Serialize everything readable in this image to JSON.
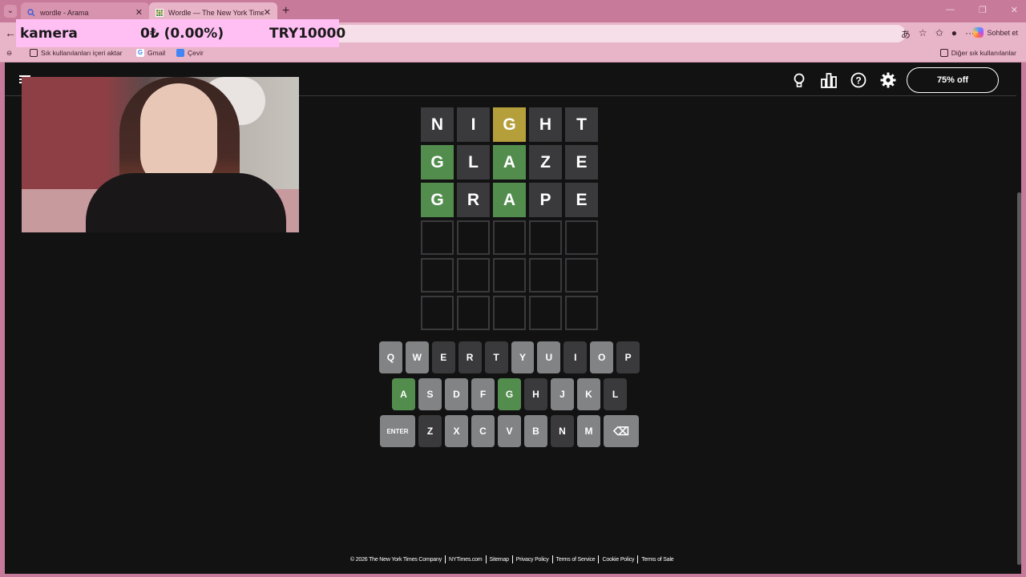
{
  "browser": {
    "tabs": [
      {
        "title": "wordle - Arama",
        "icon": "search-icon",
        "active": false
      },
      {
        "title": "Wordle — The New York Times",
        "icon": "wordle-favicon-icon",
        "active": true
      }
    ],
    "new_tab": "+",
    "copilot_label": "Sohbet et",
    "bookmarks": [
      {
        "label": "Sık kullanılanları içeri aktar",
        "icon": "import-icon"
      },
      {
        "label": "Gmail",
        "icon": "google-icon"
      },
      {
        "label": "Çevir",
        "icon": "translate-icon"
      }
    ],
    "other_bookmarks": "Diğer sık kullanılanlar"
  },
  "overlay": {
    "name": "kamera",
    "amount": "0₺ (0.00%)",
    "goal": "TRY10000"
  },
  "header": {
    "offer_label": "75% off",
    "icons": [
      "lightbulb-icon",
      "stats-icon",
      "help-icon",
      "settings-icon"
    ]
  },
  "board": {
    "rows": [
      {
        "letters": [
          "N",
          "I",
          "G",
          "H",
          "T"
        ],
        "states": [
          "absent",
          "absent",
          "present",
          "absent",
          "absent"
        ]
      },
      {
        "letters": [
          "G",
          "L",
          "A",
          "Z",
          "E"
        ],
        "states": [
          "correct",
          "absent",
          "correct",
          "absent",
          "absent"
        ]
      },
      {
        "letters": [
          "G",
          "R",
          "A",
          "P",
          "E"
        ],
        "states": [
          "correct",
          "absent",
          "correct",
          "absent",
          "absent"
        ]
      },
      {
        "letters": [
          "",
          "",
          "",
          "",
          ""
        ],
        "states": [
          "empty",
          "empty",
          "empty",
          "empty",
          "empty"
        ]
      },
      {
        "letters": [
          "",
          "",
          "",
          "",
          ""
        ],
        "states": [
          "empty",
          "empty",
          "empty",
          "empty",
          "empty"
        ]
      },
      {
        "letters": [
          "",
          "",
          "",
          "",
          ""
        ],
        "states": [
          "empty",
          "empty",
          "empty",
          "empty",
          "empty"
        ]
      }
    ]
  },
  "keyboard": {
    "rows": [
      [
        {
          "k": "Q",
          "s": "unused"
        },
        {
          "k": "W",
          "s": "unused"
        },
        {
          "k": "E",
          "s": "absent"
        },
        {
          "k": "R",
          "s": "absent"
        },
        {
          "k": "T",
          "s": "absent"
        },
        {
          "k": "Y",
          "s": "unused"
        },
        {
          "k": "U",
          "s": "unused"
        },
        {
          "k": "I",
          "s": "absent"
        },
        {
          "k": "O",
          "s": "unused"
        },
        {
          "k": "P",
          "s": "absent"
        }
      ],
      [
        {
          "k": "A",
          "s": "correct"
        },
        {
          "k": "S",
          "s": "unused"
        },
        {
          "k": "D",
          "s": "unused"
        },
        {
          "k": "F",
          "s": "unused"
        },
        {
          "k": "G",
          "s": "correct"
        },
        {
          "k": "H",
          "s": "absent"
        },
        {
          "k": "J",
          "s": "unused"
        },
        {
          "k": "K",
          "s": "unused"
        },
        {
          "k": "L",
          "s": "absent"
        }
      ],
      [
        {
          "k": "ENTER",
          "s": "unused",
          "wide": true
        },
        {
          "k": "Z",
          "s": "absent"
        },
        {
          "k": "X",
          "s": "unused"
        },
        {
          "k": "C",
          "s": "unused"
        },
        {
          "k": "V",
          "s": "unused"
        },
        {
          "k": "B",
          "s": "unused"
        },
        {
          "k": "N",
          "s": "absent"
        },
        {
          "k": "M",
          "s": "unused"
        },
        {
          "k": "⌫",
          "s": "unused",
          "wide": true
        }
      ]
    ]
  },
  "footer": {
    "links": [
      "© 2026 The New York Times Company",
      "NYTimes.com",
      "Sitemap",
      "Privacy Policy",
      "Terms of Service",
      "Cookie Policy",
      "Terms of Sale"
    ]
  },
  "colors": {
    "correct": "#538d4e",
    "present": "#b59f3b",
    "absent": "#3a3a3c",
    "unused_key": "#818384",
    "background": "#121213",
    "browser_chrome": "#e8b4c8"
  }
}
